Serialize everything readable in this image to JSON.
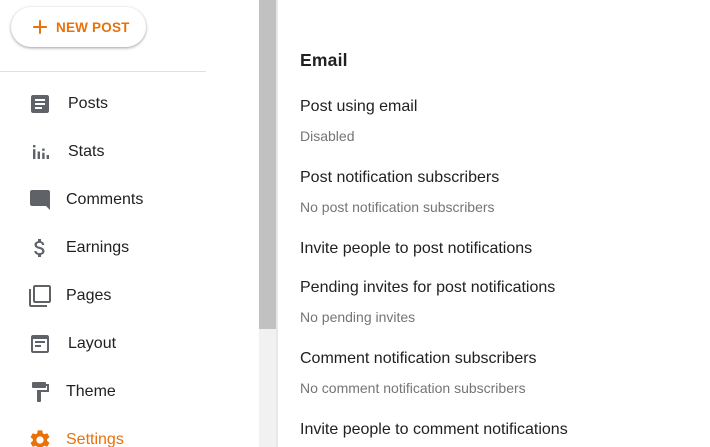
{
  "sidebar": {
    "new_post_label": "NEW POST",
    "items": [
      {
        "label": "Posts",
        "icon": "posts-icon"
      },
      {
        "label": "Stats",
        "icon": "stats-icon"
      },
      {
        "label": "Comments",
        "icon": "comments-icon"
      },
      {
        "label": "Earnings",
        "icon": "dollar-icon"
      },
      {
        "label": "Pages",
        "icon": "pages-icon"
      },
      {
        "label": "Layout",
        "icon": "layout-icon"
      },
      {
        "label": "Theme",
        "icon": "paint-roller-icon"
      },
      {
        "label": "Settings",
        "icon": "gear-icon",
        "active": true
      }
    ]
  },
  "main": {
    "section_title": "Email",
    "settings": [
      {
        "title": "Post using email",
        "subtitle": "Disabled"
      },
      {
        "title": "Post notification subscribers",
        "subtitle": "No post notification subscribers"
      },
      {
        "title": "Invite people to post notifications"
      },
      {
        "title": "Pending invites for post notifications",
        "subtitle": "No pending invites"
      },
      {
        "title": "Comment notification subscribers",
        "subtitle": "No comment notification subscribers"
      },
      {
        "title": "Invite people to comment notifications"
      }
    ]
  },
  "colors": {
    "accent": "#e8710a",
    "icon": "#5f6368",
    "text": "#212121",
    "secondary_text": "#757575"
  }
}
